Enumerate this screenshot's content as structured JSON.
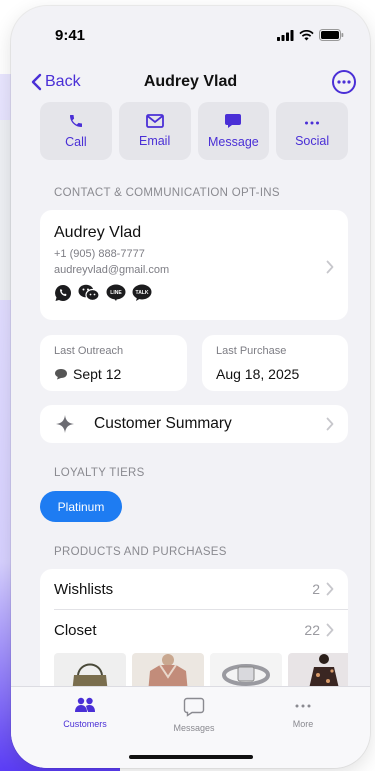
{
  "status": {
    "time": "9:41"
  },
  "nav": {
    "back_label": "Back",
    "title": "Audrey Vlad"
  },
  "actions": [
    {
      "label": "Call",
      "icon": "phone-icon"
    },
    {
      "label": "Email",
      "icon": "envelope-icon"
    },
    {
      "label": "Message",
      "icon": "chat-bubble-icon"
    },
    {
      "label": "Social",
      "icon": "ellipsis-icon"
    }
  ],
  "contact": {
    "section_label": "CONTACT & COMMUNICATION OPT-INS",
    "name": "Audrey Vlad",
    "phone": "+1 (905) 888-7777",
    "email": "audreyvlad@gmail.com",
    "channels": [
      {
        "icon": "whatsapp-icon",
        "text": ""
      },
      {
        "icon": "wechat-icon",
        "text": ""
      },
      {
        "icon": "line-icon",
        "text": "LINE"
      },
      {
        "icon": "talk-icon",
        "text": "TALK"
      }
    ]
  },
  "stats": {
    "last_outreach_label": "Last Outreach",
    "last_outreach_value": "Sept 12",
    "last_purchase_label": "Last Purchase",
    "last_purchase_value": "Aug 18, 2025"
  },
  "summary": {
    "label": "Customer Summary"
  },
  "loyalty": {
    "section_label": "LOYALTY TIERS",
    "tier": "Platinum"
  },
  "products": {
    "section_label": "PRODUCTS AND PURCHASES",
    "wishlists_label": "Wishlists",
    "wishlists_count": "2",
    "closet_label": "Closet",
    "closet_count": "22"
  },
  "tabs": [
    {
      "label": "Customers",
      "icon": "people-icon",
      "active": true
    },
    {
      "label": "Messages",
      "icon": "message-outline-icon",
      "active": false
    },
    {
      "label": "More",
      "icon": "more-dots-icon",
      "active": false
    }
  ],
  "colors": {
    "accent": "#4a2fd6",
    "tier_pill": "#1e7cf2",
    "background": "#f2f2f6"
  }
}
